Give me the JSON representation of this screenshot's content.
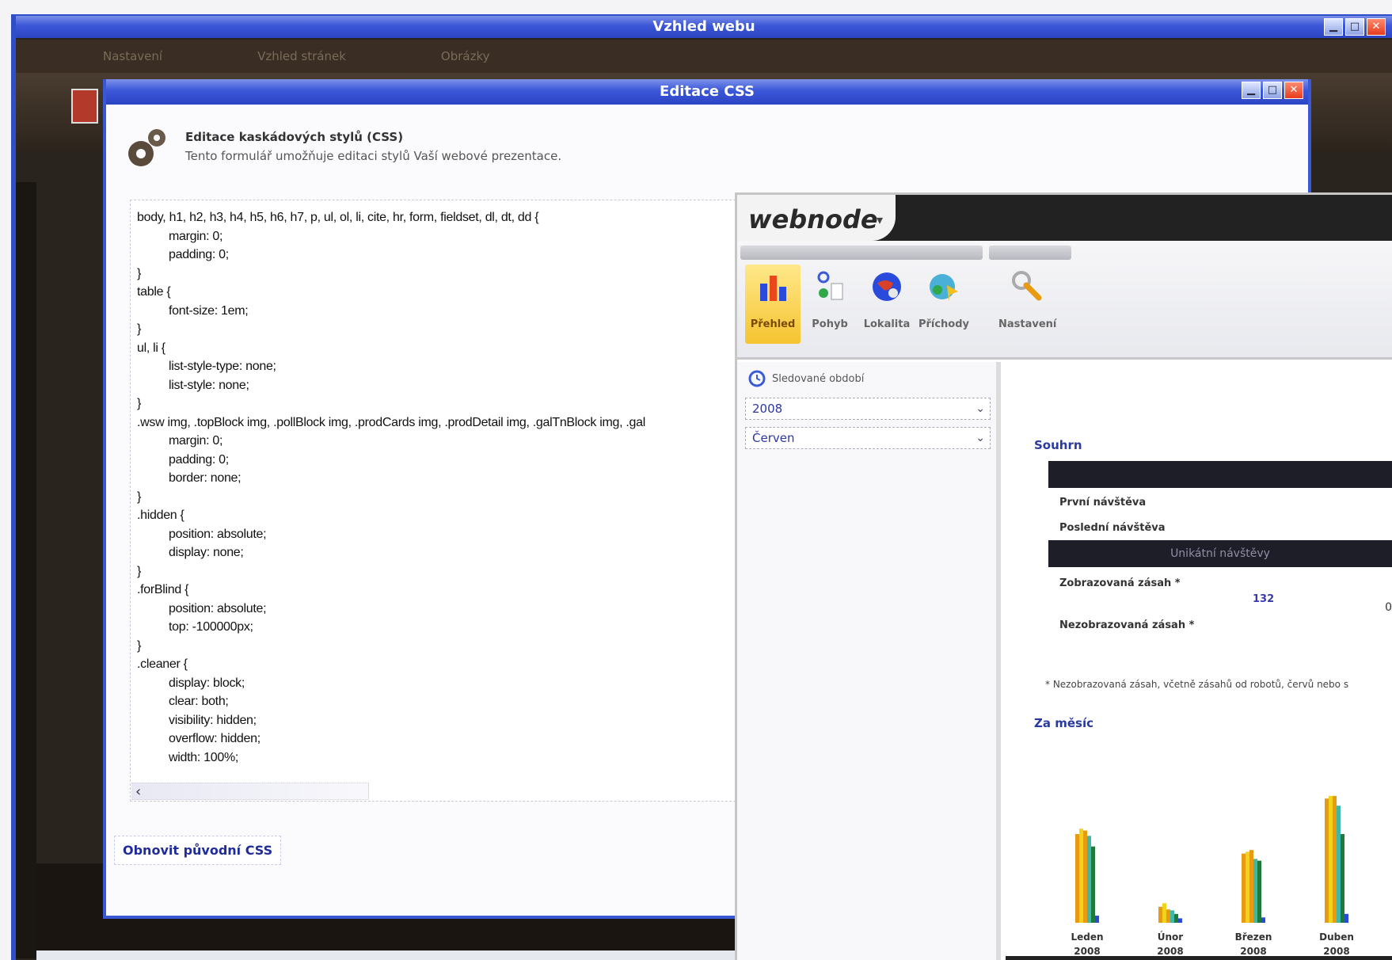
{
  "outer_window": {
    "title": "Vzhled webu",
    "menu": [
      "Nastavení",
      "Vzhled stránek",
      "Obrázky"
    ]
  },
  "css_window": {
    "title": "Editace CSS",
    "header_title": "Editace kaskádových stylů (CSS)",
    "header_subtitle": "Tento formulář umožňuje editaci stylů Vaší webové prezentace.",
    "code_lines": [
      {
        "t": "body, h1, h2, h3, h4, h5, h6, h7, p, ul, ol, li, cite, hr, form, fieldset, dl, dt, dd {",
        "i": false
      },
      {
        "t": "margin: 0;",
        "i": true
      },
      {
        "t": "padding: 0;",
        "i": true
      },
      {
        "t": "}",
        "i": false
      },
      {
        "t": "table {",
        "i": false
      },
      {
        "t": "font-size: 1em;",
        "i": true
      },
      {
        "t": "}",
        "i": false
      },
      {
        "t": "ul, li {",
        "i": false
      },
      {
        "t": "list-style-type: none;",
        "i": true
      },
      {
        "t": "list-style: none;",
        "i": true
      },
      {
        "t": "}",
        "i": false
      },
      {
        "t": ".wsw img, .topBlock img, .pollBlock img, .prodCards img, .prodDetail img, .galTnBlock img, .gal",
        "i": false
      },
      {
        "t": "margin: 0;",
        "i": true
      },
      {
        "t": "padding: 0;",
        "i": true
      },
      {
        "t": "border: none;",
        "i": true
      },
      {
        "t": "}",
        "i": false
      },
      {
        "t": ".hidden {",
        "i": false
      },
      {
        "t": "position: absolute;",
        "i": true
      },
      {
        "t": "display: none;",
        "i": true
      },
      {
        "t": "}",
        "i": false
      },
      {
        "t": ".forBlind {",
        "i": false
      },
      {
        "t": "position: absolute;",
        "i": true
      },
      {
        "t": "top: -100000px;",
        "i": true
      },
      {
        "t": "}",
        "i": false
      },
      {
        "t": ".cleaner {",
        "i": false
      },
      {
        "t": "display: block;",
        "i": true
      },
      {
        "t": "clear: both;",
        "i": true
      },
      {
        "t": "visibility: hidden;",
        "i": true
      },
      {
        "t": "overflow: hidden;",
        "i": true
      },
      {
        "t": "width: 100%;",
        "i": true
      }
    ],
    "restore_button": "Obnovit původní CSS"
  },
  "webnode": {
    "logo": "webnode",
    "tools": [
      "Přehled",
      "Pohyb",
      "Lokalita",
      "Příchody",
      "Nastavení"
    ],
    "tracked_domain": "Sledované období",
    "year": "2008",
    "month": "Červen",
    "summary_title": "Souhrn",
    "first_visit": "První návštěva",
    "last_visit": "Poslední návštěva",
    "unique_visits_header": "Unikátní návštěvy",
    "visible_domains": "Zobrazovaná zásah *",
    "visible_value": "132",
    "edge_value": "0",
    "hidden_domains": "Nezobrazovaná zásah *",
    "footnote": "* Nezobrazovaná zásah, včetně zásahů od robotů, červů nebo s",
    "monthly_title": "Za měsíc",
    "colors": {
      "accent": "#2a3aa0",
      "orange": "#e89a10",
      "yellow": "#f2d21a",
      "teal": "#3fb8a8",
      "green": "#1f7a3a",
      "blue": "#2a4adc"
    }
  },
  "chart_data": {
    "type": "bar",
    "categories": [
      "Leden 2008",
      "Únor 2008",
      "Březen 2008",
      "Duben 2008"
    ],
    "series": [
      {
        "values": [
          100,
          18,
          78,
          140
        ]
      },
      {
        "values": [
          106,
          22,
          80,
          143
        ]
      },
      {
        "values": [
          104,
          15,
          82,
          143
        ]
      },
      {
        "values": [
          98,
          14,
          72,
          132
        ]
      },
      {
        "values": [
          86,
          10,
          70,
          100
        ]
      },
      {
        "values": [
          8,
          5,
          6,
          10
        ]
      }
    ],
    "ylim": [
      0,
      150
    ]
  }
}
